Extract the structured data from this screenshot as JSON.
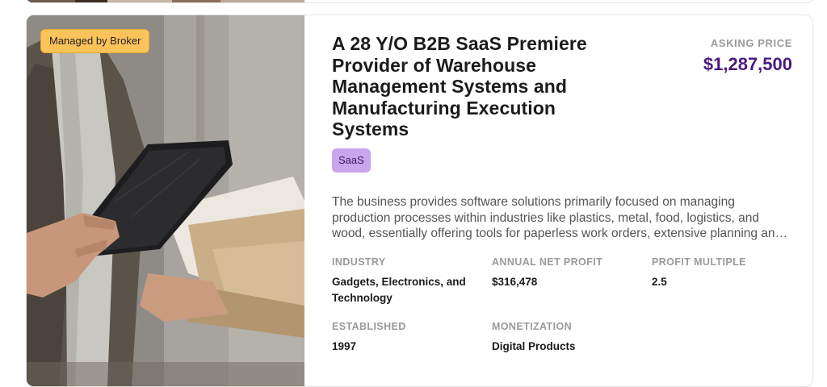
{
  "listing": {
    "badge": "Managed by Broker",
    "title": "A 28 Y/O B2B SaaS Premiere Provider of Warehouse Management Systems and Manufacturing Execution Systems",
    "asking_price_label": "ASKING PRICE",
    "asking_price": "$1,287,500",
    "tag": "SaaS",
    "description": "The business provides software solutions primarily focused on managing production processes within industries like plastics, metal, food, logistics, and wood, essentially offering tools for paperless work orders, extensive planning and scheduling capabilities, and real-time data collection.",
    "stats": {
      "industry": {
        "label": "INDUSTRY",
        "value": "Gadgets, Electronics, and Technology"
      },
      "annual_net_profit": {
        "label": "ANNUAL NET PROFIT",
        "value": "$316,478"
      },
      "profit_multiple": {
        "label": "PROFIT MULTIPLE",
        "value": "2.5"
      },
      "established": {
        "label": "ESTABLISHED",
        "value": "1997"
      },
      "monetization": {
        "label": "MONETIZATION",
        "value": "Digital Products"
      }
    }
  },
  "colors": {
    "badge_bg": "#fcc35a",
    "tag_bg": "#c9a6ec",
    "price": "#4b1a80"
  },
  "image": {
    "subject": "person-holding-tablet-and-package"
  }
}
